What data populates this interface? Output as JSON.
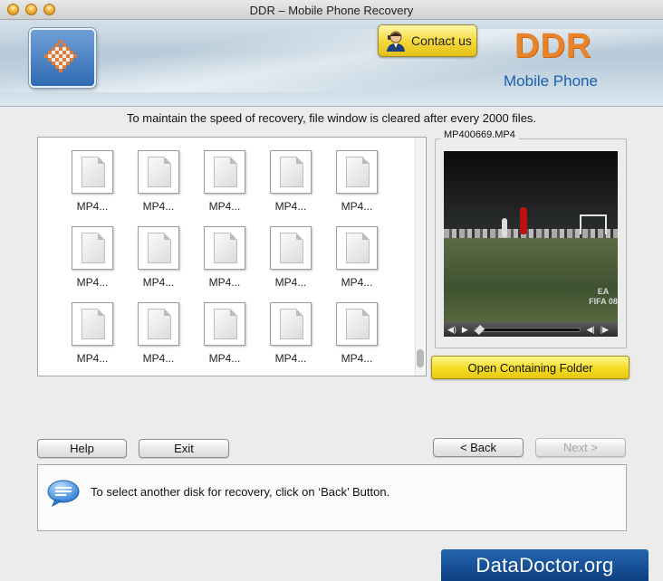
{
  "window": {
    "title": "DDR – Mobile Phone Recovery"
  },
  "header": {
    "contact_label": "Contact us",
    "brand_name": "DDR",
    "brand_product": "Mobile Phone"
  },
  "info_message": "To maintain the speed of recovery, file window is cleared after every 2000 files.",
  "files": {
    "items": [
      {
        "label": "MP4..."
      },
      {
        "label": "MP4..."
      },
      {
        "label": "MP4..."
      },
      {
        "label": "MP4..."
      },
      {
        "label": "MP4..."
      },
      {
        "label": "MP4..."
      },
      {
        "label": "MP4..."
      },
      {
        "label": "MP4..."
      },
      {
        "label": "MP4..."
      },
      {
        "label": "MP4..."
      },
      {
        "label": "MP4..."
      },
      {
        "label": "MP4..."
      },
      {
        "label": "MP4..."
      },
      {
        "label": "MP4..."
      },
      {
        "label": "MP4..."
      }
    ]
  },
  "preview": {
    "filename": "MP400669.MP4",
    "watermark": "EA FIFA 08",
    "open_folder_label": "Open Containing Folder"
  },
  "buttons": {
    "help": "Help",
    "exit": "Exit",
    "back": "< Back",
    "next": "Next >"
  },
  "status_message": "To select another disk for recovery, click on ‘Back’ Button.",
  "footer": {
    "site": "DataDoctor.org"
  },
  "colors": {
    "brand_orange": "#e8832a",
    "brand_blue": "#1d5fae",
    "highlight_yellow": "#f4dd23",
    "footer_blue": "#0d3f82"
  }
}
